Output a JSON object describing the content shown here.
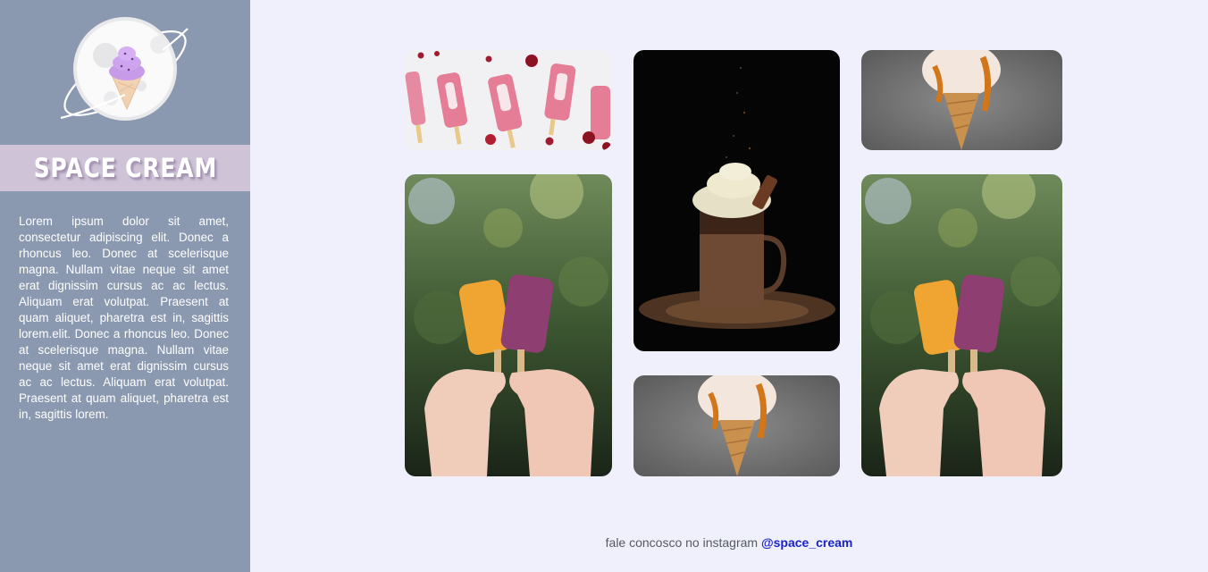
{
  "brand": {
    "title": "Space Cream"
  },
  "sidebar": {
    "description": "Lorem ipsum dolor sit amet, consectetur adipiscing elit. Donec a rhoncus leo. Donec at scelerisque magna. Nullam vitae neque sit amet erat dignissim cursus ac ac lectus. Aliquam erat volutpat. Praesent at quam aliquet, pharetra est in, sagittis lorem.elit. Donec a rhoncus leo. Donec at scelerisque magna. Nullam vitae neque sit amet erat dignissim cursus ac ac lectus. Aliquam erat volutpat. Praesent at quam aliquet, pharetra est in, sagittis lorem."
  },
  "gallery": {
    "images": [
      {
        "subject": "pink popsicles with cherries"
      },
      {
        "subject": "hands holding two popsicles"
      },
      {
        "subject": "chocolate milkshake jar"
      },
      {
        "subject": "caramel ice cream cone"
      },
      {
        "subject": "caramel ice cream cone"
      },
      {
        "subject": "hands holding two popsicles"
      }
    ]
  },
  "footer": {
    "text": "fale concosco no instagram ",
    "handle": "@space_cream"
  },
  "colors": {
    "sidebar_bg": "#8a98b0",
    "brand_band": "#cfc3d8",
    "page_bg": "#eff0fb",
    "link": "#1a22c8"
  }
}
